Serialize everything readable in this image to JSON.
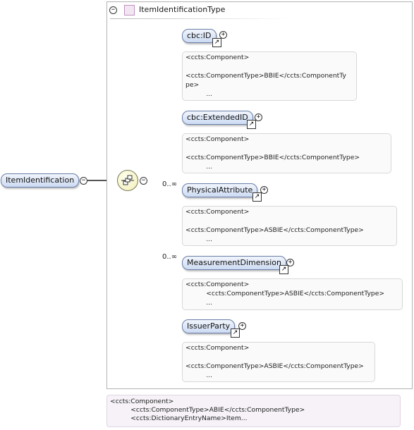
{
  "root_element": {
    "label": "ItemIdentification",
    "toggle": "−"
  },
  "type": {
    "name": "ItemIdentificationType",
    "toggle": "−"
  },
  "compositor": {
    "toggle": "−"
  },
  "children": [
    {
      "label": "cbc:ID",
      "occurrence": "",
      "annotation": "<ccts:Component>\n\n<ccts:ComponentType>BBIE</ccts:ComponentTy\npe>\n          ..."
    },
    {
      "label": "cbc:ExtendedID",
      "occurrence": "",
      "annotation": "<ccts:Component>\n\n<ccts:ComponentType>BBIE</ccts:ComponentType>\n          ..."
    },
    {
      "label": "PhysicalAttribute",
      "occurrence": "0..∞",
      "annotation": "<ccts:Component>\n\n<ccts:ComponentType>ASBIE</ccts:ComponentType>\n          ..."
    },
    {
      "label": "MeasurementDimension",
      "occurrence": "0..∞",
      "annotation": "<ccts:Component>\n          <ccts:ComponentType>ASBIE</ccts:ComponentType>\n          ..."
    },
    {
      "label": "IssuerParty",
      "occurrence": "",
      "annotation": "<ccts:Component>\n\n<ccts:ComponentType>ASBIE</ccts:ComponentType>\n          ..."
    }
  ],
  "bottom_annotation": "<ccts:Component>\n          <ccts:ComponentType>ABIE</ccts:ComponentType>\n          <ccts:DictionaryEntryName>Item...",
  "symbols": {
    "expand": "+",
    "collapse": "−",
    "ref_arrow": "↗"
  }
}
